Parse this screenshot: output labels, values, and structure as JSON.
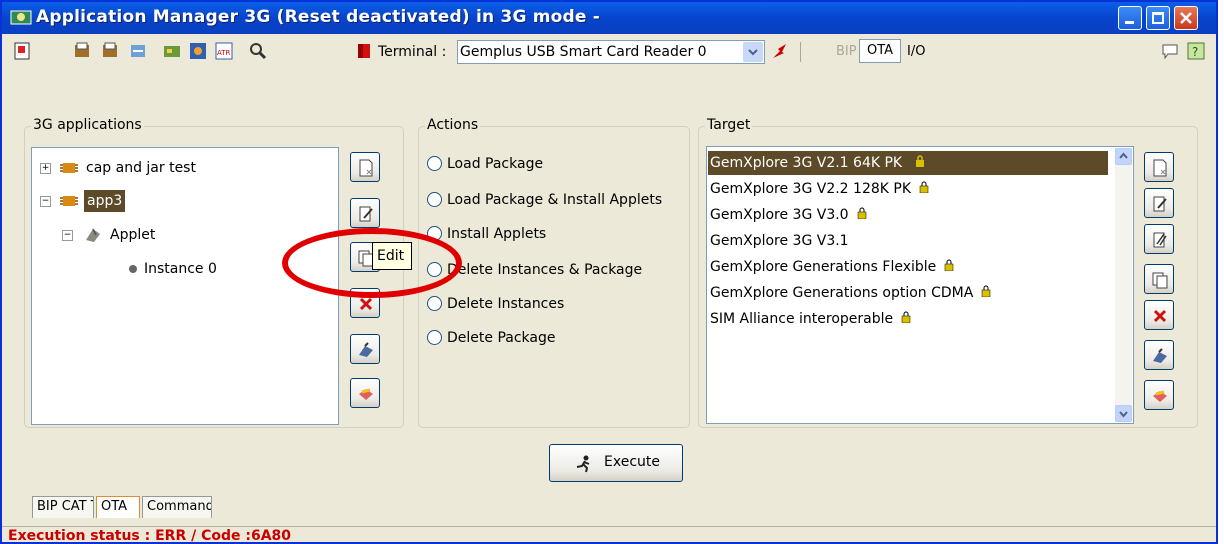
{
  "window": {
    "title": "Application Manager 3G (Reset deactivated) in 3G mode -",
    "accent_color": "#0a5fe8",
    "controls": [
      "minimize-icon",
      "maximize-icon",
      "close-icon"
    ]
  },
  "toolbar": {
    "terminal_label": "Terminal :",
    "terminal_value": "Gemplus USB Smart Card Reader 0",
    "bip_label": "BIP",
    "ota_label": "OTA",
    "io_label": "I/O",
    "left_icons": [
      "exit-icon",
      "open-icon",
      "open2-icon",
      "load-icon",
      "card-icon",
      "card2-icon",
      "atr-icon",
      "search-icon",
      "stop-icon"
    ],
    "right_icons": [
      "chat-icon",
      "help-icon"
    ]
  },
  "applications": {
    "title": "3G applications",
    "tree": [
      {
        "label": "cap and jar test",
        "expander": "+",
        "icon": "package-icon"
      },
      {
        "label": "app3",
        "expander": "−",
        "icon": "package-icon",
        "selected": true
      },
      {
        "label": "Applet",
        "expander": "−",
        "icon": "applet-icon"
      },
      {
        "label": "Instance 0",
        "icon": "instance-icon"
      }
    ],
    "buttons": [
      "new-icon",
      "edit-icon",
      "copy-icon",
      "delete-icon",
      "stamp-icon",
      "export-icon"
    ]
  },
  "actions": {
    "title": "Actions",
    "options": [
      "Load Package",
      "Load Package & Install Applets",
      "Install Applets",
      "Delete Instances & Package",
      "Delete Instances",
      "Delete Package"
    ]
  },
  "target": {
    "title": "Target",
    "items": [
      {
        "label": "GemXplore 3G V2.1 64K PK",
        "selected": true
      },
      {
        "label": "GemXplore 3G V2.2 128K PK"
      },
      {
        "label": "GemXplore 3G V3.0"
      },
      {
        "label": "GemXplore 3G V3.1"
      },
      {
        "label": "GemXplore Generations Flexible"
      },
      {
        "label": "GemXplore Generations option CDMA"
      },
      {
        "label": "SIM Alliance interoperable"
      }
    ],
    "buttons": [
      "new-icon",
      "edit-icon",
      "edit2-icon",
      "copy-icon",
      "delete-icon",
      "stamp-icon",
      "export-icon"
    ]
  },
  "execute_label": "Execute",
  "tooltip": "Edit",
  "tabs": [
    "BIP CAT TP",
    "OTA",
    "Commands"
  ],
  "status": {
    "text": "Execution status : ERR / Code :6A80",
    "color": "#c80000"
  }
}
